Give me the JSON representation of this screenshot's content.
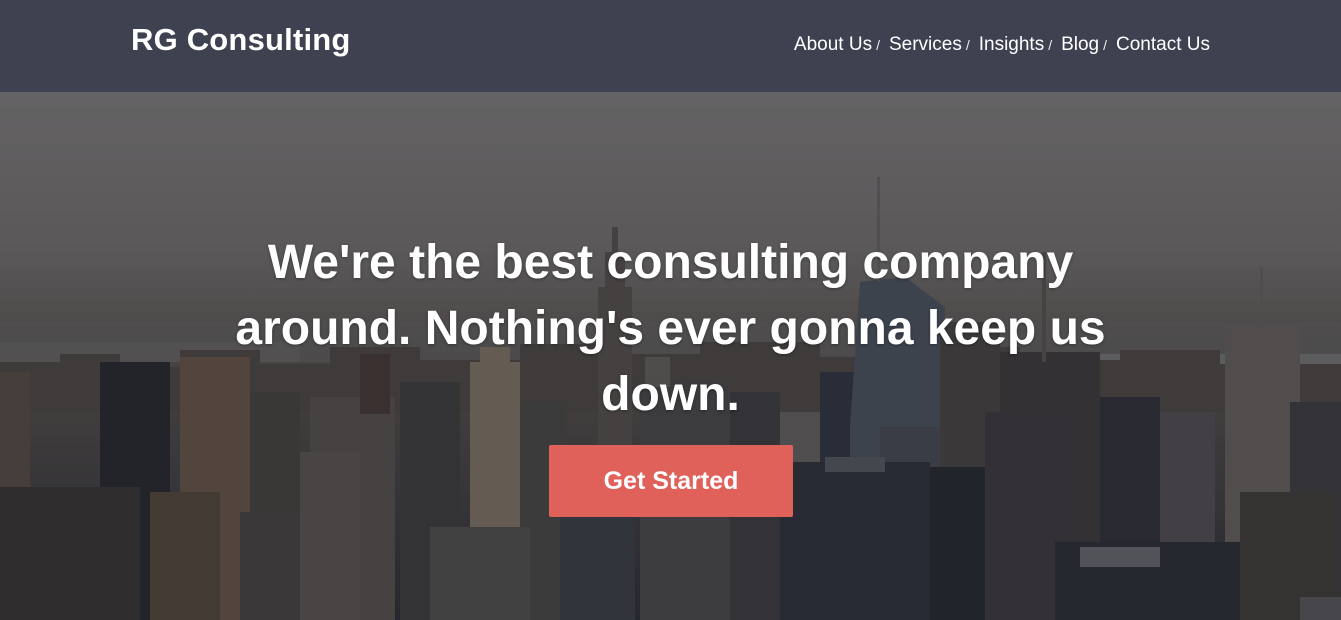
{
  "brand": {
    "name": "RG Consulting"
  },
  "nav": {
    "items": [
      {
        "label": "About Us",
        "sep": "/"
      },
      {
        "label": "Services",
        "sep": "/"
      },
      {
        "label": "Insights",
        "sep": "/"
      },
      {
        "label": "Blog",
        "sep": "/"
      },
      {
        "label": "Contact Us",
        "sep": ""
      }
    ]
  },
  "hero": {
    "headline": "We're the best consulting company around. Nothing's ever gonna keep us down.",
    "cta_label": "Get Started",
    "background_image": "city-skyline"
  },
  "colors": {
    "navbar": "#3d4150",
    "cta": "#e0605a",
    "text": "#ffffff"
  }
}
